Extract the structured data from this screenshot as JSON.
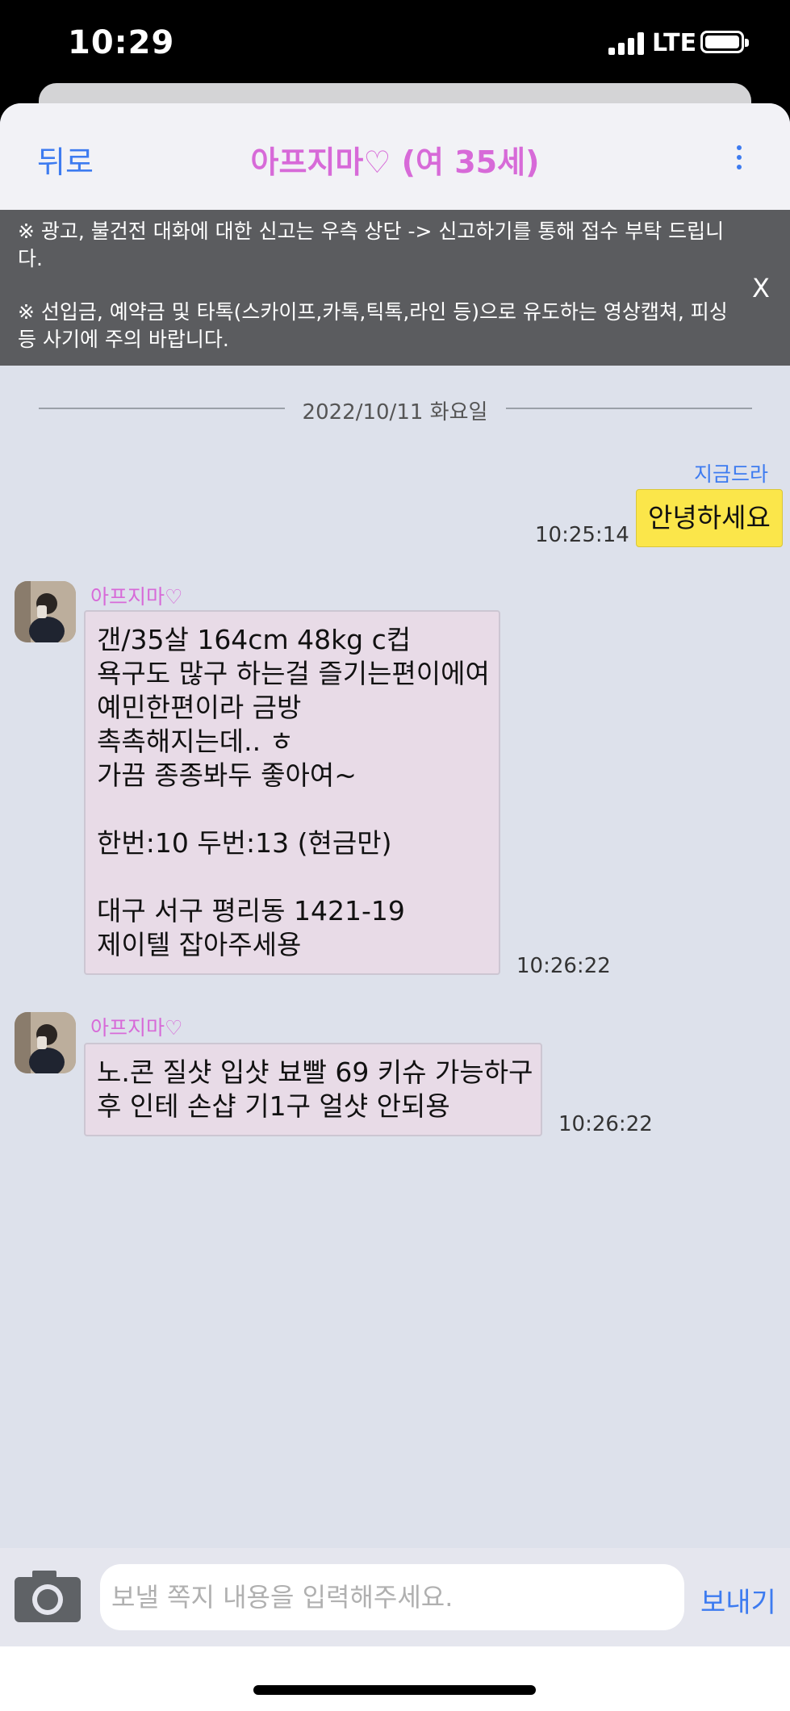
{
  "status_bar": {
    "time": "10:29",
    "network": "LTE",
    "signal_bars": 4,
    "battery_level": 1.0
  },
  "header": {
    "back_label": "뒤로",
    "title": "아프지마♡ (여 35세)",
    "more_icon": "more-vertical-icon"
  },
  "notice": {
    "line1": "※ 광고, 불건전 대화에 대한 신고는 우측 상단 -> 신고하기를 통해 접수 부탁 드립니다.",
    "line2": "※ 선입금, 예약금 및 타톡(스카이프,카톡,틱톡,라인 등)으로 유도하는 영상캡쳐, 피싱 등 사기에 주의 바랍니다.",
    "close_label": "X"
  },
  "date_divider": "2022/10/11 화요일",
  "messages": [
    {
      "direction": "out",
      "sender": "지금드라",
      "text": "안녕하세요",
      "time": "10:25:14"
    },
    {
      "direction": "in",
      "sender": "아프지마♡",
      "lines": [
        "갠/35살 164cm 48kg c컵",
        "욕구도 많구 하는걸 즐기는편이에여",
        "예민한편이라 금방",
        "촉촉해지는데.. ㅎ",
        "가끔 종종봐두 좋아여~",
        "",
        "한번:10 두번:13 (현금만)",
        "",
        "대구 서구 평리동 1421-19",
        "제이텔 잡아주세용"
      ],
      "time": "10:26:22"
    },
    {
      "direction": "in",
      "sender": "아프지마♡",
      "lines": [
        "노.콘 질샷 입샷 뵤빨 69 키슈 가능하구",
        "후 인테 손샵 기1구 얼샷 안되용"
      ],
      "time": "10:26:22"
    }
  ],
  "composer": {
    "camera_icon": "camera-icon",
    "placeholder": "보낼 쪽지 내용을 입력해주세요.",
    "value": "",
    "send_label": "보내기"
  },
  "colors": {
    "accent": "#3d7bf0",
    "title_pink": "#d76ad8",
    "background": "#dde1eb",
    "outgoing_bubble": "#fbe64a",
    "incoming_bubble": "#e8dbe7",
    "notice_bg": "#5b5c5f"
  }
}
